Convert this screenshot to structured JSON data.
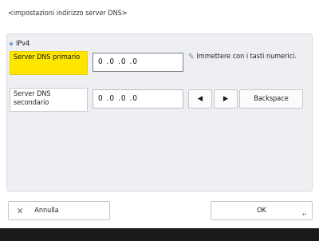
{
  "screen": {
    "title": "<impostazioni indirizzo server DNS>"
  },
  "section": {
    "label": "IPv4"
  },
  "fields": {
    "primary": {
      "label": "Server DNS primario",
      "value": "0 .0 .0 .0"
    },
    "secondary": {
      "label": "Server DNS secondario",
      "value": "0 .0 .0 .0"
    }
  },
  "hint": {
    "text": "Immettere con i tasti numerici.",
    "icon": "pencil-icon"
  },
  "keys": {
    "left": "◀",
    "right": "▶",
    "backspace": "Backspace"
  },
  "footer": {
    "cancel_label": "Annulla",
    "ok_label": "OK"
  },
  "colors": {
    "active_label": "#ffe600",
    "panel": "#eeeff2"
  }
}
